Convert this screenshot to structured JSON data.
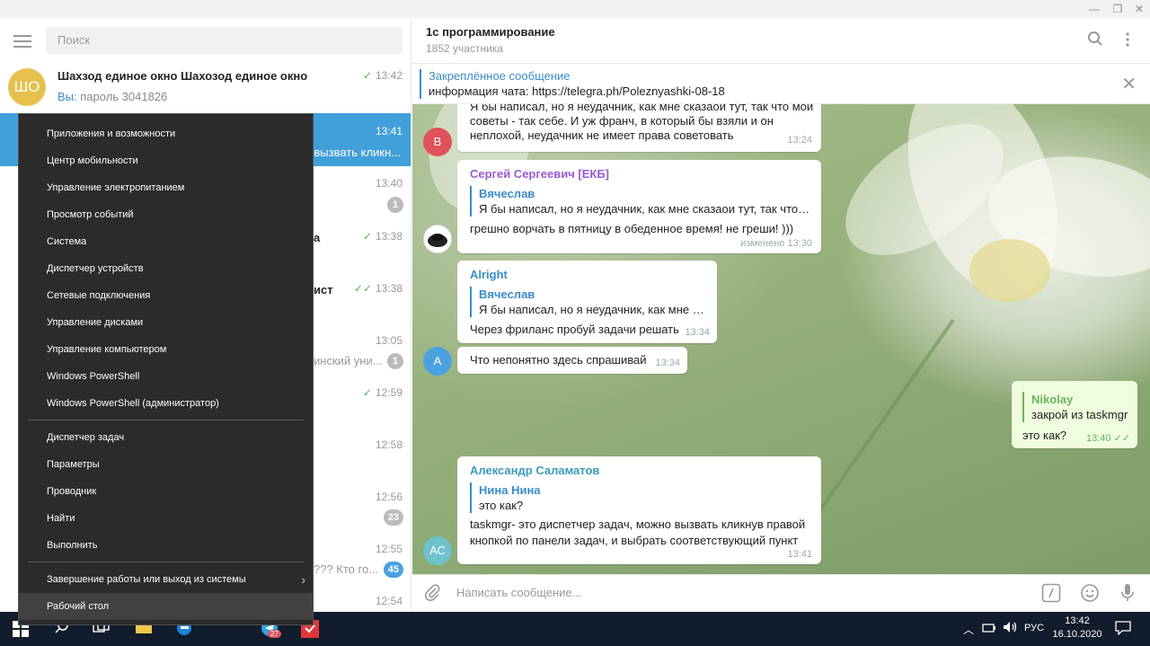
{
  "window": {
    "minimize": "—",
    "restore": "❐",
    "close": "✕"
  },
  "sidebar": {
    "search_placeholder": "Поиск",
    "chats": [
      {
        "avatar_text": "ШО",
        "avatar_color": "#e6c14d",
        "name": "Шахзод единое окно Шахозод единое окно",
        "preview_you": "Вы:",
        "preview": " пароль 3041826",
        "time": "13:42",
        "check": "✓"
      },
      {
        "time": "13:41",
        "preview_tail": "вызвать кликн..."
      },
      {
        "time": "13:40",
        "badge": "1"
      },
      {
        "time": "13:38",
        "name_tail": "а",
        "check": "✓"
      },
      {
        "time": "13:38",
        "name_tail": "ист",
        "check": "✓✓"
      },
      {
        "time": "13:05",
        "preview_tail": "инский уни...",
        "badge": "1"
      },
      {
        "time": "12:59",
        "check": "✓"
      },
      {
        "time": "12:58"
      },
      {
        "time": "12:56",
        "badge": "23"
      },
      {
        "time": "12:55",
        "preview_tail": "??? Кто го...",
        "badge": "45"
      },
      {
        "time": "12:54"
      }
    ]
  },
  "context_menu": {
    "items": [
      "Приложения и возможности",
      "Центр мобильности",
      "Управление электропитанием",
      "Просмотр событий",
      "Система",
      "Диспетчер устройств",
      "Сетевые подключения",
      "Управление дисками",
      "Управление компьютером",
      "Windows PowerShell",
      "Windows PowerShell (администратор)",
      "Диспетчер задач",
      "Параметры",
      "Проводник",
      "Найти",
      "Выполнить",
      "Завершение работы или выход из системы",
      "Рабочий стол"
    ]
  },
  "chat": {
    "title": "1с программирование",
    "subtitle": "1852 участника",
    "pinned_title": "Закреплённое сообщение",
    "pinned_text": "информация чата: https://telegra.ph/Poleznyashki-08-18",
    "input_placeholder": "Написать сообщение...",
    "messages": [
      {
        "text1": "Я бы написал, но я неудачник, как мне сказаои тут, так что мои",
        "text2": "советы - так себе. И уж франч, в который бы взяли и он",
        "text3": "неплохой, неудачник не имеет права советовать",
        "time": "13:24",
        "avatar": "В",
        "avatar_color": "#e0525b"
      },
      {
        "sender": "Сергей Сергеевич [ЕКБ]",
        "sender_color": "#9c59d1",
        "reply_name": "Вячеслав",
        "reply_text": "Я бы написал, но я неудачник, как мне сказаои тут, так что м...",
        "text": "грешно ворчать в пятницу в обеденное время! не греши! )))",
        "time": "изменено 13:30"
      },
      {
        "sender": "Alright",
        "sender_color": "#3a8cc9",
        "reply_name": "Вячеслав",
        "reply_text": "Я бы написал, но я неудачник, как мне ск...",
        "text": "Через фриланс пробуй задачи решать",
        "time": "13:34"
      },
      {
        "text": "Что непонятно здесь спрашивай",
        "time": "13:34",
        "avatar": "А",
        "avatar_color": "#4aa1df"
      },
      {
        "reply_name": "Nikolay",
        "reply_text": "закрой из taskmgr",
        "text": "это как?",
        "time": "13:40",
        "ticks": "✓✓"
      },
      {
        "sender": "Александр Саламатов",
        "sender_color": "#3a9bb8",
        "reply_name": "Нина Нина",
        "reply_text": "это как?",
        "text1": "taskmgr- это диспетчер задач, можно вызвать кликнув правой",
        "text2": "кнопкой по панели задач, и выбрать соответствующий пункт",
        "time": "13:41",
        "avatar": "АС",
        "avatar_color": "#6fc1cc"
      }
    ]
  },
  "taskbar": {
    "lang": "РУС",
    "time": "13:42",
    "date": "16.10.2020",
    "badge": "27"
  }
}
